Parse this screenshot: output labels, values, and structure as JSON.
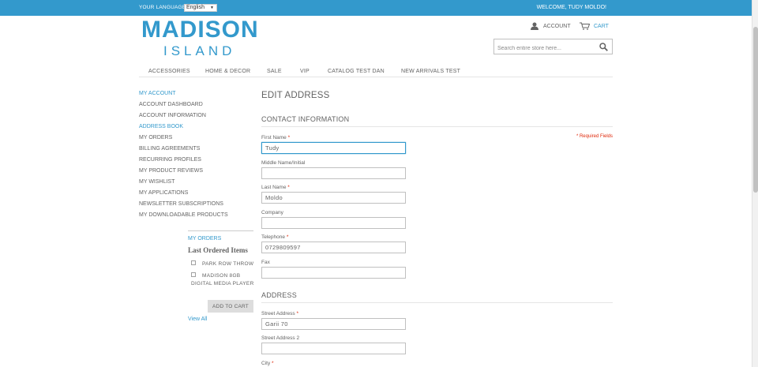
{
  "topbar": {
    "language_label": "YOUR LANGUAGE:",
    "language_value": "English",
    "welcome": "WELCOME, TUDY MOLDO!"
  },
  "logo": {
    "main": "MADISON",
    "sub": "ISLAND"
  },
  "header": {
    "account_label": "ACCOUNT",
    "cart_label": "CART",
    "search_placeholder": "Search entire store here..."
  },
  "nav": [
    "ACCESSORIES",
    "HOME & DECOR",
    "SALE",
    "VIP",
    "CATALOG TEST DAN",
    "NEW ARRIVALS TEST"
  ],
  "sidebar": {
    "title": "MY ACCOUNT",
    "items": [
      {
        "label": "ACCOUNT DASHBOARD",
        "active": false
      },
      {
        "label": "ACCOUNT INFORMATION",
        "active": false
      },
      {
        "label": "ADDRESS BOOK",
        "active": true
      },
      {
        "label": "MY ORDERS",
        "active": false
      },
      {
        "label": "BILLING AGREEMENTS",
        "active": false
      },
      {
        "label": "RECURRING PROFILES",
        "active": false
      },
      {
        "label": "MY PRODUCT REVIEWS",
        "active": false
      },
      {
        "label": "MY WISHLIST",
        "active": false
      },
      {
        "label": "MY APPLICATIONS",
        "active": false
      },
      {
        "label": "NEWSLETTER SUBSCRIPTIONS",
        "active": false
      },
      {
        "label": "MY DOWNLOADABLE PRODUCTS",
        "active": false
      }
    ]
  },
  "orders_block": {
    "title": "MY ORDERS",
    "heading": "Last Ordered Items",
    "items": [
      "PARK ROW THROW",
      "MADISON 8GB",
      "DIGITAL MEDIA PLAYER"
    ],
    "add_to_cart": "ADD TO CART",
    "view_all": "View All"
  },
  "form": {
    "page_title": "EDIT ADDRESS",
    "contact_section": "CONTACT INFORMATION",
    "address_section": "ADDRESS",
    "required_note": "* Required Fields",
    "fields": {
      "first_name": {
        "label": "First Name",
        "value": "Tudy"
      },
      "middle_name": {
        "label": "Middle Name/Initial",
        "value": ""
      },
      "last_name": {
        "label": "Last Name",
        "value": "Moldo"
      },
      "company": {
        "label": "Company",
        "value": ""
      },
      "telephone": {
        "label": "Telephone",
        "value": "0729809597"
      },
      "fax": {
        "label": "Fax",
        "value": ""
      },
      "street1": {
        "label": "Street Address",
        "value": "Garii 70"
      },
      "street2": {
        "label": "Street Address 2",
        "value": ""
      },
      "city": {
        "label": "City",
        "value": ""
      }
    },
    "required_marker": "*"
  },
  "colors": {
    "accent": "#3399cc",
    "required": "#df280a",
    "text": "#636363"
  }
}
